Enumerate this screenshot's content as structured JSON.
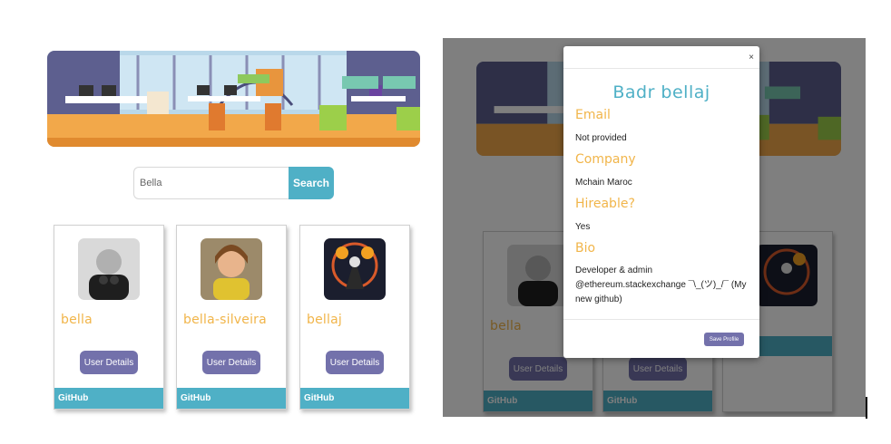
{
  "left_view": {
    "search": {
      "value": "Bella",
      "button_label": "Search"
    },
    "users": [
      {
        "name": "bella",
        "details_label": "User Details",
        "footer": "GitHub"
      },
      {
        "name": "bella-silveira",
        "details_label": "User Details",
        "footer": "GitHub"
      },
      {
        "name": "bellaj",
        "details_label": "User Details",
        "footer": "GitHub"
      }
    ]
  },
  "right_view": {
    "users": [
      {
        "name": "bella",
        "details_label": "User Details",
        "footer": "GitHub"
      },
      {
        "name": "",
        "details_label": "User Details",
        "footer": "GitHub"
      },
      {
        "name": ""
      }
    ],
    "modal": {
      "close": "×",
      "title": "Badr bellaj",
      "email_label": "Email",
      "email_value": "Not provided",
      "company_label": "Company",
      "company_value": "Mchain Maroc",
      "hireable_label": "Hireable?",
      "hireable_value": "Yes",
      "bio_label": "Bio",
      "bio_value": "Developer & admin @ethereum.stackexchange ¯\\_(ツ)_/¯ (My new github)",
      "save_label": "Save Profile"
    }
  },
  "colors": {
    "accent_teal": "#4fb0c6",
    "accent_orange": "#f1b54a",
    "button_purple": "#7371ab"
  },
  "icons": [
    "close-icon"
  ]
}
